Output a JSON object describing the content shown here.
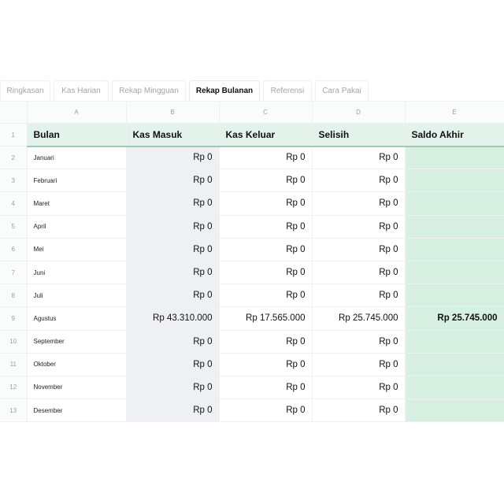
{
  "tabs": [
    {
      "label": "Ringkasan",
      "active": false
    },
    {
      "label": "Kas Harian",
      "active": false
    },
    {
      "label": "Rekap Mingguan",
      "active": false
    },
    {
      "label": "Rekap Bulanan",
      "active": true
    },
    {
      "label": "Referensi",
      "active": false
    },
    {
      "label": "Cara Pakai",
      "active": false
    }
  ],
  "columns": [
    "A",
    "B",
    "C",
    "D",
    "E"
  ],
  "header_row": {
    "row_number": "1",
    "cells": [
      "Bulan",
      "Kas Masuk",
      "Kas Keluar",
      "Selisih",
      "Saldo Akhir"
    ]
  },
  "rows": [
    {
      "row_number": "2",
      "bulan": "Januari",
      "kas_masuk": "Rp 0",
      "kas_keluar": "Rp 0",
      "selisih": "Rp 0",
      "saldo_akhir": ""
    },
    {
      "row_number": "3",
      "bulan": "Februari",
      "kas_masuk": "Rp 0",
      "kas_keluar": "Rp 0",
      "selisih": "Rp 0",
      "saldo_akhir": ""
    },
    {
      "row_number": "4",
      "bulan": "Maret",
      "kas_masuk": "Rp 0",
      "kas_keluar": "Rp 0",
      "selisih": "Rp 0",
      "saldo_akhir": ""
    },
    {
      "row_number": "5",
      "bulan": "April",
      "kas_masuk": "Rp 0",
      "kas_keluar": "Rp 0",
      "selisih": "Rp 0",
      "saldo_akhir": ""
    },
    {
      "row_number": "6",
      "bulan": "Mei",
      "kas_masuk": "Rp 0",
      "kas_keluar": "Rp 0",
      "selisih": "Rp 0",
      "saldo_akhir": ""
    },
    {
      "row_number": "7",
      "bulan": "Juni",
      "kas_masuk": "Rp 0",
      "kas_keluar": "Rp 0",
      "selisih": "Rp 0",
      "saldo_akhir": ""
    },
    {
      "row_number": "8",
      "bulan": "Juli",
      "kas_masuk": "Rp 0",
      "kas_keluar": "Rp 0",
      "selisih": "Rp 0",
      "saldo_akhir": ""
    },
    {
      "row_number": "9",
      "bulan": "Agustus",
      "kas_masuk": "Rp 43.310.000",
      "kas_keluar": "Rp 17.565.000",
      "selisih": "Rp 25.745.000",
      "saldo_akhir": "Rp 25.745.000"
    },
    {
      "row_number": "10",
      "bulan": "September",
      "kas_masuk": "Rp 0",
      "kas_keluar": "Rp 0",
      "selisih": "Rp 0",
      "saldo_akhir": ""
    },
    {
      "row_number": "11",
      "bulan": "Oktober",
      "kas_masuk": "Rp 0",
      "kas_keluar": "Rp 0",
      "selisih": "Rp 0",
      "saldo_akhir": ""
    },
    {
      "row_number": "12",
      "bulan": "November",
      "kas_masuk": "Rp 0",
      "kas_keluar": "Rp 0",
      "selisih": "Rp 0",
      "saldo_akhir": ""
    },
    {
      "row_number": "13",
      "bulan": "Desember",
      "kas_masuk": "Rp 0",
      "kas_keluar": "Rp 0",
      "selisih": "Rp 0",
      "saldo_akhir": ""
    }
  ],
  "colors": {
    "header_fill": "#e3f2ea",
    "header_underline": "#9ccbb1",
    "kas_masuk_fill": "#eef0f4",
    "saldo_fill": "#d7f0e2"
  }
}
